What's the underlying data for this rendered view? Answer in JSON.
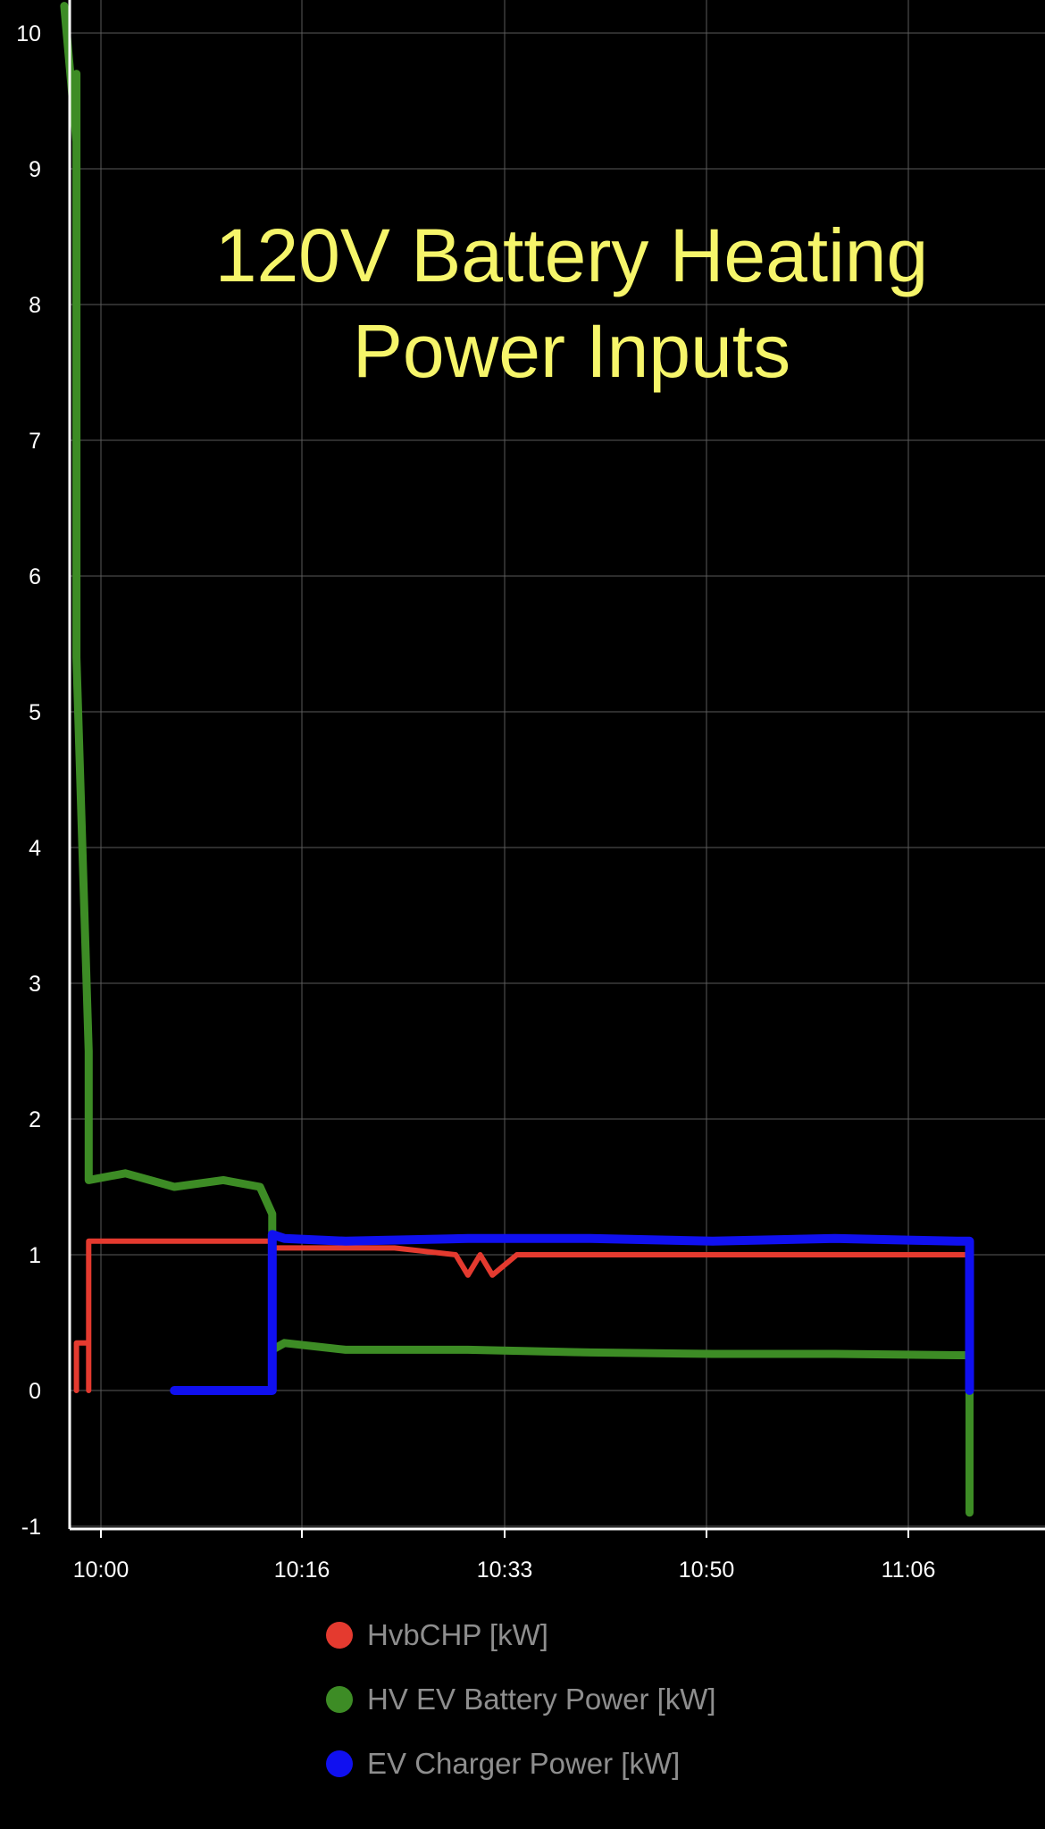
{
  "chart_data": {
    "type": "line",
    "title_lines": [
      "120V Battery Heating",
      "Power Inputs"
    ],
    "xlabel": "",
    "ylabel": "",
    "x_tick_labels": [
      "10:00",
      "10:16",
      "10:33",
      "10:50",
      "11:06"
    ],
    "y_tick_labels": [
      "10",
      "9",
      "8",
      "7",
      "6",
      "5",
      "4",
      "3",
      "2",
      "1",
      "0",
      "-1"
    ],
    "ylim": [
      -1,
      10
    ],
    "grid": true,
    "colors": {
      "background": "#000000",
      "grid": "#5a5a5a",
      "axis": "#ffffff",
      "title": "#f6f56a",
      "legend_text": "#8e8e8e"
    },
    "legend": {
      "placement": "bottom",
      "entries": [
        {
          "label": "HvbCHP [kW]",
          "color": "#e43a2f"
        },
        {
          "label": "HV EV Battery Power [kW]",
          "color": "#3d8c25"
        },
        {
          "label": "EV Charger Power [kW]",
          "color": "#1010f0"
        }
      ]
    },
    "series": [
      {
        "name": "HvbCHP [kW]",
        "color": "#e43a2f",
        "x": [
          "09:58",
          "09:58",
          "09:59",
          "09:59",
          "09:59",
          "09:59",
          "10:06",
          "10:14",
          "10:14",
          "10:24",
          "10:29",
          "10:30",
          "10:31",
          "10:32",
          "10:34",
          "10:40",
          "11:10",
          "11:11",
          "11:11"
        ],
        "y": [
          0,
          0.35,
          0.35,
          0,
          1.1,
          1.1,
          1.1,
          1.1,
          1.05,
          1.05,
          1.0,
          0.85,
          1.0,
          0.85,
          1.0,
          1.0,
          1.0,
          1.0,
          0
        ]
      },
      {
        "name": "HV EV Battery Power [kW]",
        "color": "#3d8c25",
        "x": [
          "09:57",
          "09:58",
          "09:58",
          "09:58",
          "09:59",
          "09:59",
          "09:59",
          "10:02",
          "10:06",
          "10:10",
          "10:13",
          "10:14",
          "10:14",
          "10:15",
          "10:20",
          "10:30",
          "10:40",
          "10:50",
          "11:00",
          "11:10",
          "11:11",
          "11:11",
          "11:11"
        ],
        "y": [
          10.2,
          9.2,
          9.7,
          5.4,
          2.5,
          1.6,
          1.55,
          1.6,
          1.5,
          1.55,
          1.5,
          1.3,
          0.3,
          0.35,
          0.3,
          0.3,
          0.28,
          0.27,
          0.27,
          0.26,
          0.26,
          -0.1,
          -0.9
        ]
      },
      {
        "name": "EV Charger Power [kW]",
        "color": "#1010f0",
        "x": [
          "10:06",
          "10:10",
          "10:14",
          "10:14",
          "10:15",
          "10:20",
          "10:30",
          "10:40",
          "10:50",
          "11:00",
          "11:10",
          "11:11",
          "11:11"
        ],
        "y": [
          0,
          0,
          0,
          1.15,
          1.12,
          1.1,
          1.12,
          1.12,
          1.1,
          1.12,
          1.1,
          1.1,
          0
        ]
      }
    ]
  }
}
